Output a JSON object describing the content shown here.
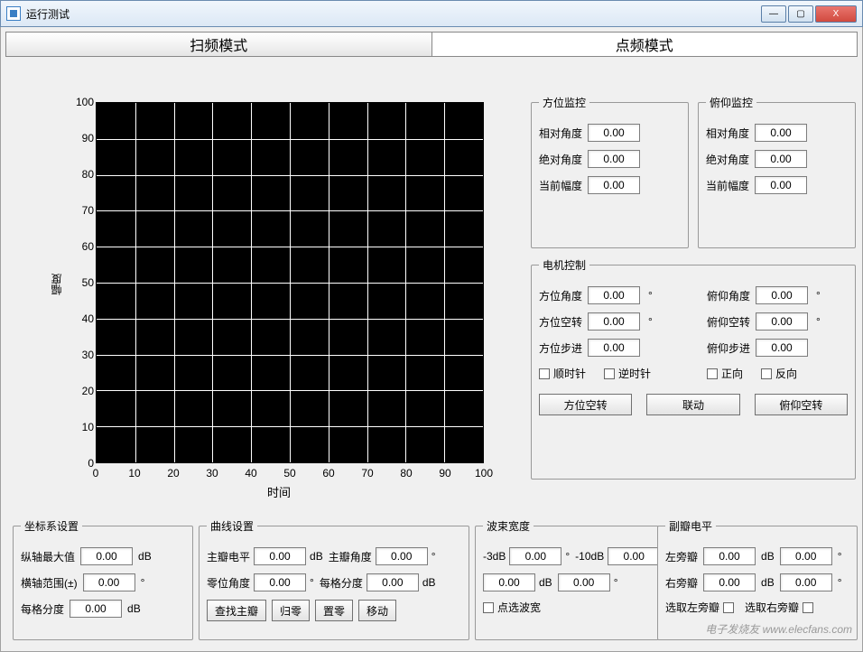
{
  "window": {
    "title": "运行测试",
    "min": "—",
    "max": "▢",
    "close": "X"
  },
  "tabs": {
    "sweep": "扫频模式",
    "point": "点频模式"
  },
  "chart_data": {
    "type": "line",
    "categories": [
      0,
      10,
      20,
      30,
      40,
      50,
      60,
      70,
      80,
      90,
      100
    ],
    "values": [],
    "title": "",
    "xlabel": "时间",
    "ylabel": "幅度",
    "xlim": [
      0,
      100
    ],
    "ylim": [
      0,
      100
    ],
    "yticks": [
      0,
      10,
      20,
      30,
      40,
      50,
      60,
      70,
      80,
      90,
      100
    ],
    "xticks": [
      0,
      10,
      20,
      30,
      40,
      50,
      60,
      70,
      80,
      90,
      100
    ]
  },
  "azmon": {
    "title": "方位监控",
    "rel_label": "相对角度",
    "rel": "0.00",
    "abs_label": "绝对角度",
    "abs": "0.00",
    "amp_label": "当前幅度",
    "amp": "0.00"
  },
  "elmon": {
    "title": "俯仰监控",
    "rel_label": "相对角度",
    "rel": "0.00",
    "abs_label": "绝对角度",
    "abs": "0.00",
    "amp_label": "当前幅度",
    "amp": "0.00"
  },
  "motor": {
    "title": "电机控制",
    "az_angle_label": "方位角度",
    "az_angle": "0.00",
    "az_idle_label": "方位空转",
    "az_idle": "0.00",
    "az_step_label": "方位步进",
    "az_step": "0.00",
    "el_angle_label": "俯仰角度",
    "el_angle": "0.00",
    "el_idle_label": "俯仰空转",
    "el_idle": "0.00",
    "el_step_label": "俯仰步进",
    "el_step": "0.00",
    "cw": "顺时针",
    "ccw": "逆时针",
    "fwd": "正向",
    "rev": "反向",
    "btn_az_idle": "方位空转",
    "btn_link": "联动",
    "btn_el_idle": "俯仰空转"
  },
  "coord": {
    "title": "坐标系设置",
    "ymax_label": "纵轴最大值",
    "ymax": "0.00",
    "ymax_unit": "dB",
    "xrange_label": "横轴范围(±)",
    "xrange": "0.00",
    "xrange_unit": "°",
    "grid_label": "每格分度",
    "grid": "0.00",
    "grid_unit": "dB"
  },
  "curve": {
    "title": "曲线设置",
    "main_lvl_label": "主瓣电平",
    "main_lvl": "0.00",
    "main_lvl_unit": "dB",
    "main_ang_label": "主瓣角度",
    "main_ang": "0.00",
    "main_ang_unit": "°",
    "zero_ang_label": "零位角度",
    "zero_ang": "0.00",
    "zero_ang_unit": "°",
    "grid_label": "每格分度",
    "grid": "0.00",
    "grid_unit": "dB",
    "btn_find": "查找主瓣",
    "btn_home": "归零",
    "btn_zero": "置零",
    "btn_move": "移动"
  },
  "beam": {
    "title": "波束宽度",
    "m3_label": "-3dB",
    "m3": "0.00",
    "m3_unit": "°",
    "m10_label": "-10dB",
    "m10": "0.00",
    "m10_unit": "°",
    "custom": "0.00",
    "custom_unit": "dB",
    "custom2": "0.00",
    "custom2_unit": "°",
    "chk_label": "点选波宽"
  },
  "side": {
    "title": "副瓣电平",
    "left_label": "左旁瓣",
    "left": "0.00",
    "left_unit": "dB",
    "left2": "0.00",
    "left2_unit": "°",
    "right_label": "右旁瓣",
    "right": "0.00",
    "right_unit": "dB",
    "right2": "0.00",
    "right2_unit": "°",
    "pick_left": "选取左旁瓣",
    "pick_right": "选取右旁瓣"
  },
  "watermark": "电子发烧友 www.elecfans.com"
}
